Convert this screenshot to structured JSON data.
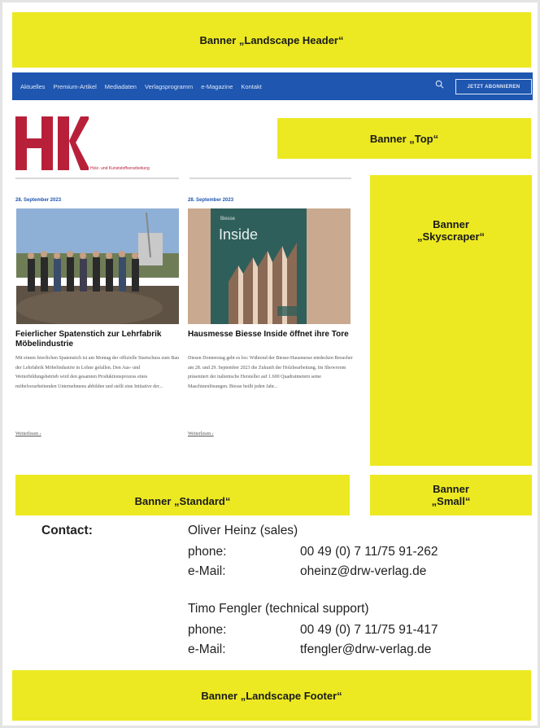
{
  "banners": {
    "landscape_header": "Banner „Landscape Header“",
    "top": "Banner „Top“",
    "skyscraper_line1": "Banner",
    "skyscraper_line2": "„Skyscraper“",
    "standard": "Banner „Standard“",
    "small_line1": "Banner",
    "small_line2": "„Small“",
    "landscape_footer": "Banner „Landscape Footer“"
  },
  "nav": {
    "items": [
      "Aktuelles",
      "Premium-Artikel",
      "Mediadaten",
      "Verlagsprogramm",
      "e-Magazine",
      "Kontakt"
    ],
    "subscribe_label": "JETZT ABONNIEREN",
    "search_icon": "search-icon"
  },
  "logo": {
    "text": "HK",
    "tagline": "Holz- und Kunststoffverarbeitung",
    "color": "#b8203a"
  },
  "articles": [
    {
      "date": "28. September 2023",
      "title": "Feierlicher Spatenstich zur Lehrfabrik Möbelindustrie",
      "text": "Mit einem feierlichen Spatenstich ist am Montag der offizielle Startschuss zum Bau der Lehrfabrik Möbelindustrie in Lohne gefallen. Den Aus- und Weiterbildungsbetrieb wird den gesamten Produktionsprozess eines möbelverarbeitenden Unternehmens abbilden und stellt eine Initiative der...",
      "more": "Weiterlesen ›"
    },
    {
      "date": "28. September 2023",
      "title": "Hausmesse Biesse Inside öffnet ihre Tore",
      "text": "Diesen Donnerstag geht es los: Während der Biesse-Hausmesse entdecken Besucher am 28. und 29. September 2023 die Zukunft der Holzbearbeitung. Im Showroom präsentiert der italienische Hersteller auf 1.600 Quadratmetern seine Maschinenlösungen. Biesse heißt jeden Jahr...",
      "more": "Weiterlesen ›",
      "image_brand": "Biesse",
      "image_word": "Inside"
    }
  ],
  "contact": {
    "label": "Contact:",
    "persons": [
      {
        "name": "Oliver Heinz (sales)",
        "phone_label": "phone:",
        "phone": "00 49 (0) 7 11/75 91-262",
        "email_label": "e-Mail:",
        "email": "oheinz@drw-verlag.de"
      },
      {
        "name": "Timo Fengler (technical support)",
        "phone_label": "phone:",
        "phone": "00 49 (0) 7 11/75 91-417",
        "email_label": "e-Mail:",
        "email": "tfengler@drw-verlag.de"
      }
    ]
  },
  "colors": {
    "banner": "#ece922",
    "nav": "#1e56b0",
    "brand": "#b8203a"
  }
}
